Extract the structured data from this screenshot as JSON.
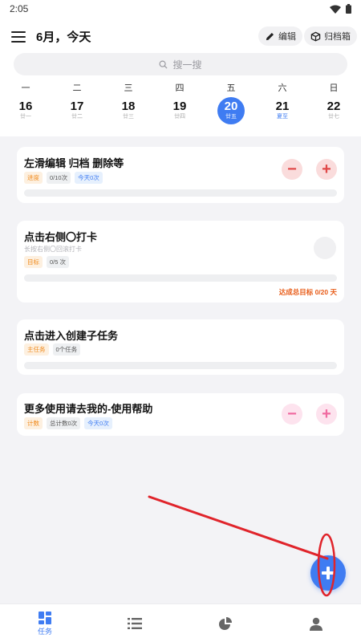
{
  "status_bar": {
    "time": "2:05"
  },
  "header": {
    "title": "6月，今天",
    "edit_label": "编辑",
    "archive_label": "归档箱",
    "search_placeholder": "搜一搜"
  },
  "week": [
    {
      "weekday": "一",
      "day": "16",
      "lunar": "廿一",
      "selected": false
    },
    {
      "weekday": "二",
      "day": "17",
      "lunar": "廿二",
      "selected": false
    },
    {
      "weekday": "三",
      "day": "18",
      "lunar": "廿三",
      "selected": false
    },
    {
      "weekday": "四",
      "day": "19",
      "lunar": "廿四",
      "selected": false
    },
    {
      "weekday": "五",
      "day": "20",
      "lunar": "廿五",
      "selected": true
    },
    {
      "weekday": "六",
      "day": "21",
      "lunar": "夏至",
      "selected": false
    },
    {
      "weekday": "日",
      "day": "22",
      "lunar": "廿七",
      "selected": false
    }
  ],
  "cards": [
    {
      "title": "左滑编辑 归档 删除等",
      "tags": [
        "进度",
        "0/10次",
        "今天0次"
      ]
    },
    {
      "title": "点击右侧〇打卡",
      "subtitle": "长按右侧〇回滚打卡",
      "tags": [
        "目标",
        "0/5 次"
      ],
      "goal": "达成总目标 0/20 天"
    },
    {
      "title": "点击进入创建子任务",
      "tags": [
        "主任务",
        "0个任务"
      ]
    },
    {
      "title": "更多使用请去我的-使用帮助",
      "tags": [
        "计数",
        "总计数0次",
        "今天0次"
      ]
    }
  ],
  "tabbar": {
    "tasks_label": "任务"
  },
  "colors": {
    "accent": "#3f7cf2",
    "annotation": "#e0242b"
  }
}
